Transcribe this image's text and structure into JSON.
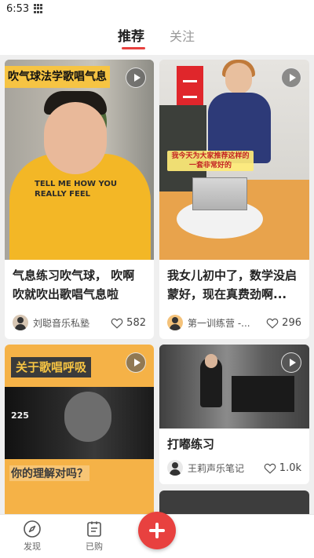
{
  "status_bar": {
    "time": "6:53"
  },
  "tabs": [
    {
      "label": "推荐",
      "active": true
    },
    {
      "label": "关注",
      "active": false
    }
  ],
  "feed": [
    {
      "thumbnail_text": "吹气球法学歌唱气息",
      "shirt_text": "TELL ME HOW YOU REALLY FEEL",
      "title": "气息练习吹气球， 吹啊吹就吹出歌唱气息啦",
      "author": "刘聪音乐私塾",
      "likes": "582"
    },
    {
      "thumbnail_text": "我今天为大家推荐这样的一套非常好的",
      "title": "我女儿初中了，数学没启蒙好，现在真费劲啊...",
      "author": "第一训练营 -...",
      "likes": "296"
    },
    {
      "thumbnail_text": "关于歌唱呼吸",
      "thumbnail_subtext": "你的理解对吗？",
      "thumbnail_label": "225",
      "title": "",
      "author": "",
      "likes": ""
    },
    {
      "thumbnail_text": "",
      "title": "打嘟练习",
      "author": "王莉声乐笔记",
      "likes": "1.0k"
    }
  ],
  "bottom_nav": [
    {
      "label": "发现",
      "icon": "compass-icon"
    },
    {
      "label": "已购",
      "icon": "list-icon"
    }
  ],
  "colors": {
    "accent": "#e8413f",
    "banner_yellow": "#f6c443"
  }
}
